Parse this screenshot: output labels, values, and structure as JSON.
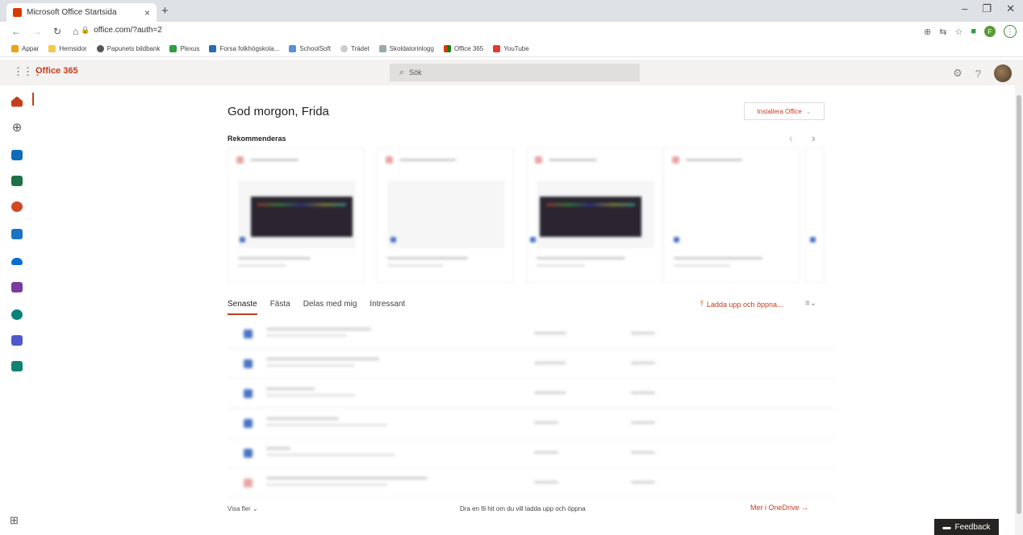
{
  "browser": {
    "tab_title": "Microsoft Office Startsida",
    "tab_close": "×",
    "new_tab": "+",
    "win_controls": [
      "–",
      "❐",
      "✕"
    ],
    "url": "office.com/?auth=2",
    "profile_initial": "F",
    "menu_glyph": "⋮"
  },
  "bookmarks": [
    {
      "label": "Appar",
      "color": "#e8a317"
    },
    {
      "label": "Hemsidor",
      "color": "#f2c94c"
    },
    {
      "label": "Papunets bildbank",
      "color": "#555555"
    },
    {
      "label": "Plexus",
      "color": "#2f9e44"
    },
    {
      "label": "Forsa folkhögskola...",
      "color": "#2b6cb0"
    },
    {
      "label": "SchoolSoft",
      "color": "#5a8fd8"
    },
    {
      "label": "Trädet",
      "color": "#cccccc"
    },
    {
      "label": "Skoldatorinlogg",
      "color": "#9aa"
    },
    {
      "label": "Office 365",
      "color": "#d83b01"
    },
    {
      "label": "YouTube",
      "color": "#e53935"
    }
  ],
  "header": {
    "brand": "Office 365",
    "search_placeholder": "Sök"
  },
  "rail": {
    "apps": [
      {
        "name": "home",
        "color": "#c43e1c"
      },
      {
        "name": "create",
        "color": "#555555"
      },
      {
        "name": "outlook",
        "color": "#0f6cbd"
      },
      {
        "name": "excel",
        "color": "#1e7145"
      },
      {
        "name": "powerpoint",
        "color": "#d24726"
      },
      {
        "name": "outlook-alt",
        "color": "#1a73c4"
      },
      {
        "name": "onedrive",
        "color": "#0a6ed1"
      },
      {
        "name": "onenote",
        "color": "#7a3d9f"
      },
      {
        "name": "sharepoint",
        "color": "#07837a"
      },
      {
        "name": "teams",
        "color": "#5059c9"
      },
      {
        "name": "sway",
        "color": "#108272"
      }
    ]
  },
  "main": {
    "greeting": "God morgon, Frida",
    "install_label": "Installera Office",
    "recommended_title": "Rekommenderas",
    "tabs": [
      "Senaste",
      "Fästa",
      "Delas med mig",
      "Intressant"
    ],
    "upload_label": "Ladda upp och öppna...",
    "show_more": "Visa fler",
    "drop_hint": "Dra en fil hit om du vill ladda upp och öppna",
    "more_onedrive": "Mer i OneDrive →",
    "feedback": "Feedback"
  },
  "colors": {
    "accent": "#c43e1c",
    "header_bg": "#f3f2f1"
  }
}
